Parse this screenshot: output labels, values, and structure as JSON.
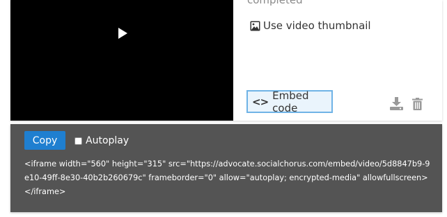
{
  "video_card": {
    "status_text": "completed",
    "use_thumbnail_label": "Use video thumbnail",
    "embed_button_label": "Embed code",
    "icons": {
      "play": "play-icon",
      "image": "image-icon",
      "code": "code-icon",
      "download": "download-icon",
      "trash": "trash-icon"
    }
  },
  "embed_panel": {
    "copy_label": "Copy",
    "autoplay_label": "Autoplay",
    "autoplay_checked": false,
    "code": "<iframe width=\"560\" height=\"315\" src=\"https://advocate.socialchorus.com/embed/video/5d8847b9-9e10-49ff-8e30-40b2b260679c\" frameborder=\"0\" allow=\"autoplay; encrypted-media\" allowfullscreen></iframe>"
  },
  "colors": {
    "video_bg": "#000000",
    "panel_bg": "#545454",
    "copy_button": "#1f7fd0",
    "embed_button_border": "#6fb3e6",
    "icon_grey": "#9a9a9a"
  }
}
